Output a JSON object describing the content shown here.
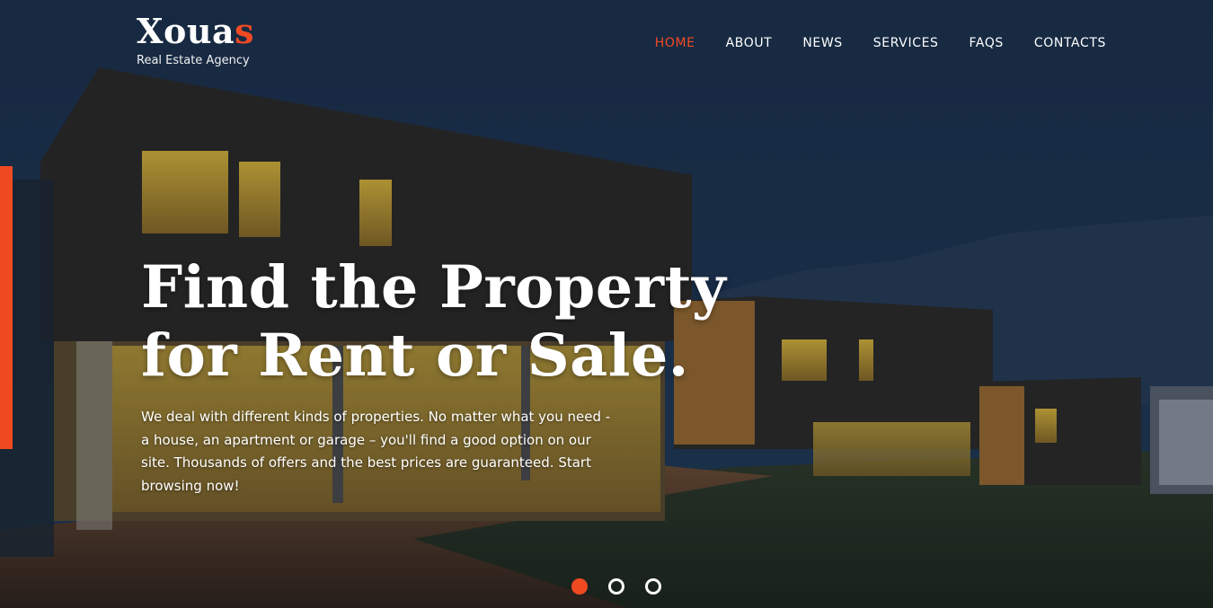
{
  "brand": {
    "name_main": "Xoua",
    "name_accent": "s",
    "tagline": "Real Estate Agency",
    "accent_color": "#f04a23"
  },
  "nav": {
    "items": [
      {
        "label": "HOME",
        "active": true
      },
      {
        "label": "ABOUT",
        "active": false
      },
      {
        "label": "NEWS",
        "active": false
      },
      {
        "label": "SERVICES",
        "active": false
      },
      {
        "label": "FAQS",
        "active": false
      },
      {
        "label": "CONTACTS",
        "active": false
      }
    ]
  },
  "hero": {
    "headline_line1": "Find the Property",
    "headline_line2": "for Rent or Sale.",
    "lead": "We deal with different kinds of properties. No matter what you need - a house, an apartment or garage – you'll find a good option on our site. Thousands of offers and the best prices are guaranteed. Start browsing now!"
  },
  "slider": {
    "slide_count": 3,
    "active_index": 0
  }
}
